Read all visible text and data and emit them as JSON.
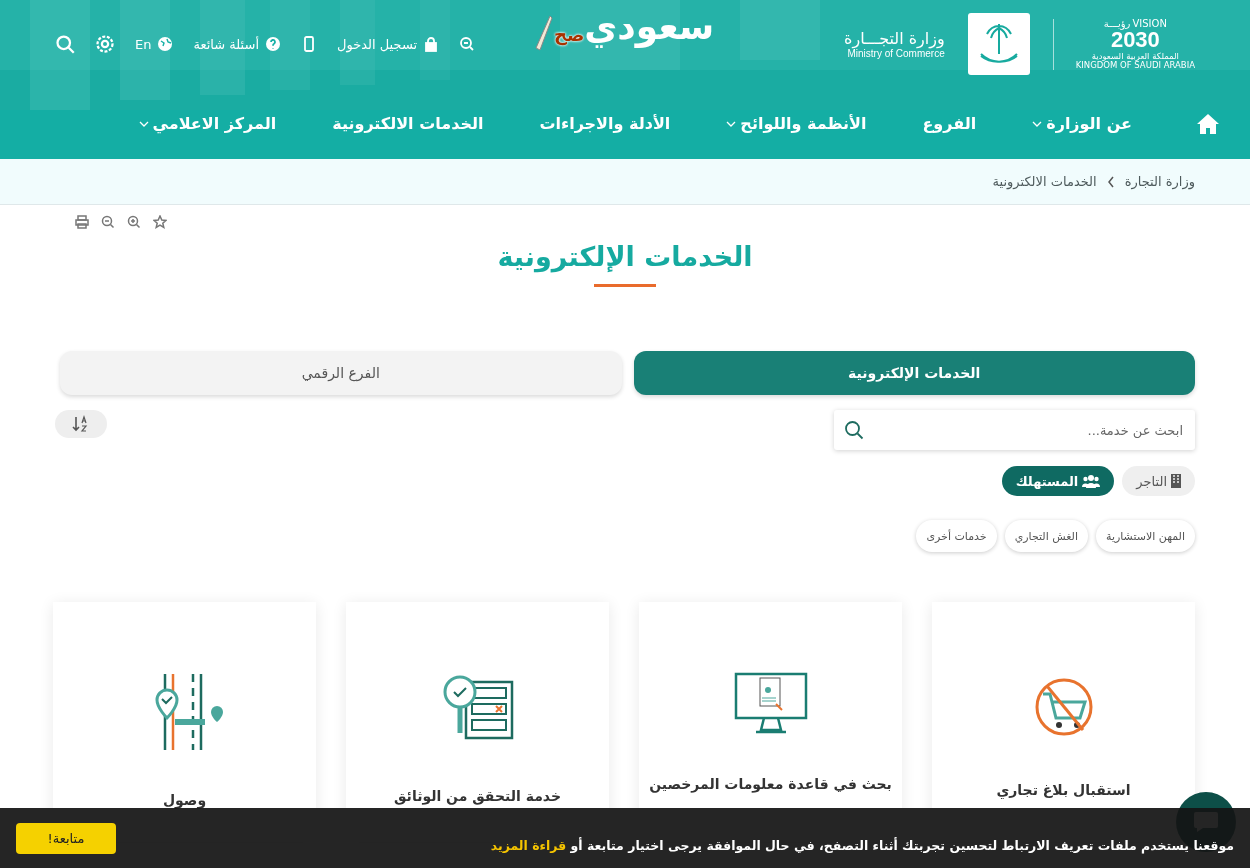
{
  "header": {
    "vision": {
      "top_latin": "VISION",
      "top_arabic": "رؤيـــة",
      "year": "2030",
      "line_arabic": "المملكة العربية السعودية",
      "line_latin": "KINGDOM OF SAUDI ARABIA"
    },
    "ministry": {
      "name_arabic": "وزارة التجـــارة",
      "name_latin": "Ministry of Commerce"
    },
    "campaign_logo": {
      "main": "سعودي",
      "accent": "صح"
    },
    "top_links": [
      {
        "kind": "zoom"
      },
      {
        "kind": "login",
        "label": "تسجيل الدخول"
      },
      {
        "kind": "mobile"
      },
      {
        "kind": "faq",
        "label": "أسئلة شائعة"
      },
      {
        "kind": "language",
        "label": "En"
      },
      {
        "kind": "settings"
      },
      {
        "kind": "search"
      }
    ],
    "nav": [
      {
        "kind": "home"
      },
      {
        "kind": "link",
        "label": "عن الوزارة",
        "has_menu": true
      },
      {
        "kind": "link",
        "label": "الفروع",
        "has_menu": false
      },
      {
        "kind": "link",
        "label": "الأنظمة واللوائح",
        "has_menu": true
      },
      {
        "kind": "link",
        "label": "الأدلة والاجراءات",
        "has_menu": false
      },
      {
        "kind": "link",
        "label": "الخدمات الالكترونية",
        "has_menu": false
      },
      {
        "kind": "link",
        "label": "المركز الاعلامي",
        "has_menu": true
      }
    ]
  },
  "breadcrumb": [
    "وزارة التجارة",
    "الخدمات الالكترونية"
  ],
  "title": "الخدمات الإلكترونية",
  "tabs": [
    {
      "label": "الخدمات الإلكترونية",
      "selected": true
    },
    {
      "label": "الفرع الرقمي",
      "selected": false
    }
  ],
  "search": {
    "placeholder": "ابحث عن خدمة..."
  },
  "audience": [
    {
      "kind": "merchant",
      "label": "التاجر",
      "selected": false
    },
    {
      "kind": "consumer",
      "label": "المستهلك",
      "selected": true
    }
  ],
  "categories": [
    "المهن الاستشارية",
    "الغش التجاري",
    "خدمات أخرى"
  ],
  "cards": [
    {
      "kind": "no-cart",
      "title": "استقبال بلاغ تجاري"
    },
    {
      "kind": "monitor",
      "title": "بحث في قاعدة معلومات المرخصين"
    },
    {
      "kind": "checklist",
      "title": "خدمة التحقق من الوثائق"
    },
    {
      "kind": "map",
      "title": "وصول"
    }
  ],
  "cookie_bar": {
    "text": "موقعنا يستخدم ملفات تعريف الارتباط لتحسين تجربتك أثناء التصفح، في حال الموافقة يرجى اختيار متابعة أو",
    "link": "قراءة المزيد",
    "button": "متابعة!"
  }
}
